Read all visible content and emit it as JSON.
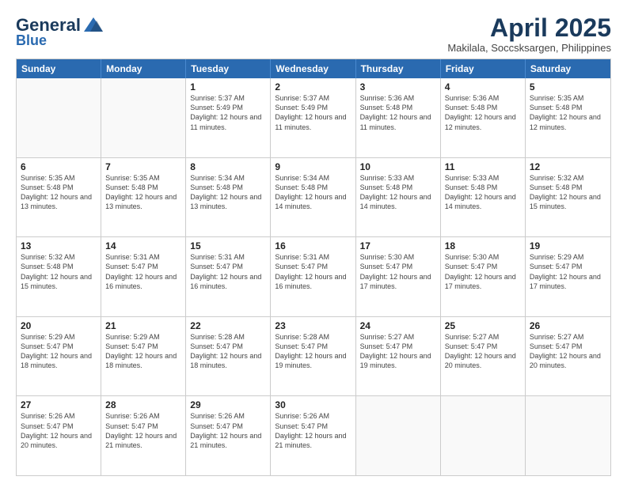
{
  "logo": {
    "line1": "General",
    "line2": "Blue"
  },
  "title": "April 2025",
  "subtitle": "Makilala, Soccsksargen, Philippines",
  "header_days": [
    "Sunday",
    "Monday",
    "Tuesday",
    "Wednesday",
    "Thursday",
    "Friday",
    "Saturday"
  ],
  "rows": [
    [
      {
        "day": "",
        "info": ""
      },
      {
        "day": "",
        "info": ""
      },
      {
        "day": "1",
        "info": "Sunrise: 5:37 AM\nSunset: 5:49 PM\nDaylight: 12 hours and 11 minutes."
      },
      {
        "day": "2",
        "info": "Sunrise: 5:37 AM\nSunset: 5:49 PM\nDaylight: 12 hours and 11 minutes."
      },
      {
        "day": "3",
        "info": "Sunrise: 5:36 AM\nSunset: 5:48 PM\nDaylight: 12 hours and 11 minutes."
      },
      {
        "day": "4",
        "info": "Sunrise: 5:36 AM\nSunset: 5:48 PM\nDaylight: 12 hours and 12 minutes."
      },
      {
        "day": "5",
        "info": "Sunrise: 5:35 AM\nSunset: 5:48 PM\nDaylight: 12 hours and 12 minutes."
      }
    ],
    [
      {
        "day": "6",
        "info": "Sunrise: 5:35 AM\nSunset: 5:48 PM\nDaylight: 12 hours and 13 minutes."
      },
      {
        "day": "7",
        "info": "Sunrise: 5:35 AM\nSunset: 5:48 PM\nDaylight: 12 hours and 13 minutes."
      },
      {
        "day": "8",
        "info": "Sunrise: 5:34 AM\nSunset: 5:48 PM\nDaylight: 12 hours and 13 minutes."
      },
      {
        "day": "9",
        "info": "Sunrise: 5:34 AM\nSunset: 5:48 PM\nDaylight: 12 hours and 14 minutes."
      },
      {
        "day": "10",
        "info": "Sunrise: 5:33 AM\nSunset: 5:48 PM\nDaylight: 12 hours and 14 minutes."
      },
      {
        "day": "11",
        "info": "Sunrise: 5:33 AM\nSunset: 5:48 PM\nDaylight: 12 hours and 14 minutes."
      },
      {
        "day": "12",
        "info": "Sunrise: 5:32 AM\nSunset: 5:48 PM\nDaylight: 12 hours and 15 minutes."
      }
    ],
    [
      {
        "day": "13",
        "info": "Sunrise: 5:32 AM\nSunset: 5:48 PM\nDaylight: 12 hours and 15 minutes."
      },
      {
        "day": "14",
        "info": "Sunrise: 5:31 AM\nSunset: 5:47 PM\nDaylight: 12 hours and 16 minutes."
      },
      {
        "day": "15",
        "info": "Sunrise: 5:31 AM\nSunset: 5:47 PM\nDaylight: 12 hours and 16 minutes."
      },
      {
        "day": "16",
        "info": "Sunrise: 5:31 AM\nSunset: 5:47 PM\nDaylight: 12 hours and 16 minutes."
      },
      {
        "day": "17",
        "info": "Sunrise: 5:30 AM\nSunset: 5:47 PM\nDaylight: 12 hours and 17 minutes."
      },
      {
        "day": "18",
        "info": "Sunrise: 5:30 AM\nSunset: 5:47 PM\nDaylight: 12 hours and 17 minutes."
      },
      {
        "day": "19",
        "info": "Sunrise: 5:29 AM\nSunset: 5:47 PM\nDaylight: 12 hours and 17 minutes."
      }
    ],
    [
      {
        "day": "20",
        "info": "Sunrise: 5:29 AM\nSunset: 5:47 PM\nDaylight: 12 hours and 18 minutes."
      },
      {
        "day": "21",
        "info": "Sunrise: 5:29 AM\nSunset: 5:47 PM\nDaylight: 12 hours and 18 minutes."
      },
      {
        "day": "22",
        "info": "Sunrise: 5:28 AM\nSunset: 5:47 PM\nDaylight: 12 hours and 18 minutes."
      },
      {
        "day": "23",
        "info": "Sunrise: 5:28 AM\nSunset: 5:47 PM\nDaylight: 12 hours and 19 minutes."
      },
      {
        "day": "24",
        "info": "Sunrise: 5:27 AM\nSunset: 5:47 PM\nDaylight: 12 hours and 19 minutes."
      },
      {
        "day": "25",
        "info": "Sunrise: 5:27 AM\nSunset: 5:47 PM\nDaylight: 12 hours and 20 minutes."
      },
      {
        "day": "26",
        "info": "Sunrise: 5:27 AM\nSunset: 5:47 PM\nDaylight: 12 hours and 20 minutes."
      }
    ],
    [
      {
        "day": "27",
        "info": "Sunrise: 5:26 AM\nSunset: 5:47 PM\nDaylight: 12 hours and 20 minutes."
      },
      {
        "day": "28",
        "info": "Sunrise: 5:26 AM\nSunset: 5:47 PM\nDaylight: 12 hours and 21 minutes."
      },
      {
        "day": "29",
        "info": "Sunrise: 5:26 AM\nSunset: 5:47 PM\nDaylight: 12 hours and 21 minutes."
      },
      {
        "day": "30",
        "info": "Sunrise: 5:26 AM\nSunset: 5:47 PM\nDaylight: 12 hours and 21 minutes."
      },
      {
        "day": "",
        "info": ""
      },
      {
        "day": "",
        "info": ""
      },
      {
        "day": "",
        "info": ""
      }
    ]
  ]
}
